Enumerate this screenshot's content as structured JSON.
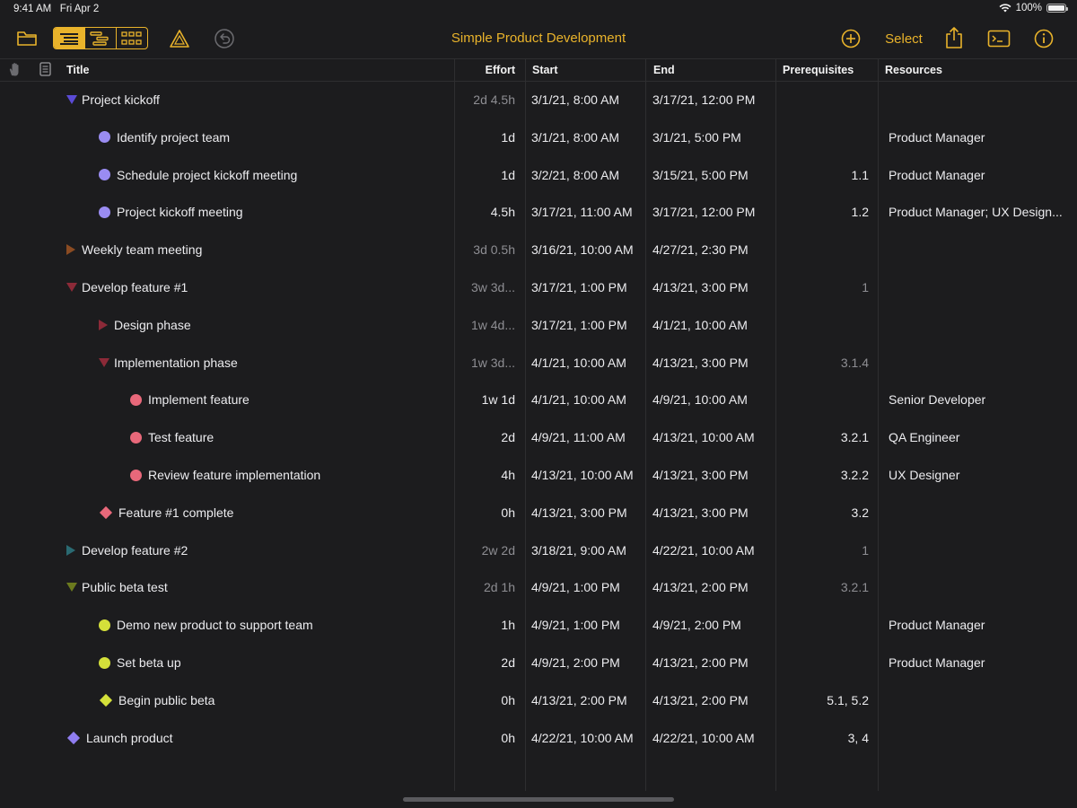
{
  "status": {
    "time": "9:41 AM",
    "date": "Fri Apr 2",
    "battery": "100%",
    "battery_level": 1.0
  },
  "toolbar": {
    "title": "Simple Product Development",
    "select_label": "Select",
    "icons": [
      "folder-icon",
      "outline-view-icon",
      "split-view-icon",
      "gantt-view-icon",
      "warnings-triangle-icon",
      "undo-icon",
      "add-circle-icon",
      "share-icon",
      "console-icon",
      "info-icon"
    ],
    "accent": "#e9b32b"
  },
  "columns": {
    "title": "Title",
    "effort": "Effort",
    "start": "Start",
    "end": "End",
    "prereq": "Prerequisites",
    "resources": "Resources"
  },
  "rows": [
    {
      "title": "Project kickoff",
      "effort": "2d 4.5h",
      "start": "3/1/21, 8:00 AM",
      "end": "3/17/21, 12:00 PM",
      "prereq": "",
      "resources": "",
      "level": 0,
      "marker": "tri-down",
      "color": "#5b4bd6",
      "group": true
    },
    {
      "title": "Identify project team",
      "effort": "1d",
      "start": "3/1/21, 8:00 AM",
      "end": "3/1/21, 5:00 PM",
      "prereq": "",
      "resources": "Product Manager",
      "level": 1,
      "marker": "dot",
      "color": "#9a8cf2",
      "group": false
    },
    {
      "title": "Schedule project kickoff meeting",
      "effort": "1d",
      "start": "3/2/21, 8:00 AM",
      "end": "3/15/21, 5:00 PM",
      "prereq": "1.1",
      "resources": "Product Manager",
      "level": 1,
      "marker": "dot",
      "color": "#9a8cf2",
      "group": false
    },
    {
      "title": "Project kickoff meeting",
      "effort": "4.5h",
      "start": "3/17/21, 11:00 AM",
      "end": "3/17/21, 12:00 PM",
      "prereq": "1.2",
      "resources": "Product Manager; UX Design...",
      "level": 1,
      "marker": "dot",
      "color": "#9a8cf2",
      "group": false
    },
    {
      "title": "Weekly team meeting",
      "effort": "3d 0.5h",
      "start": "3/16/21, 10:00 AM",
      "end": "4/27/21, 2:30 PM",
      "prereq": "",
      "resources": "",
      "level": 0,
      "marker": "tri-right",
      "color": "#8a4b22",
      "group": true
    },
    {
      "title": "Develop feature #1",
      "effort": "3w 3d...",
      "start": "3/17/21, 1:00 PM",
      "end": "4/13/21, 3:00 PM",
      "prereq": "1",
      "resources": "",
      "level": 0,
      "marker": "tri-down",
      "color": "#8c2a38",
      "group": true
    },
    {
      "title": "Design phase",
      "effort": "1w 4d...",
      "start": "3/17/21, 1:00 PM",
      "end": "4/1/21, 10:00 AM",
      "prereq": "",
      "resources": "",
      "level": 1,
      "marker": "tri-right",
      "color": "#8c2a38",
      "group": true
    },
    {
      "title": "Implementation phase",
      "effort": "1w 3d...",
      "start": "4/1/21, 10:00 AM",
      "end": "4/13/21, 3:00 PM",
      "prereq": "3.1.4",
      "resources": "",
      "level": 1,
      "marker": "tri-down",
      "color": "#8c2a38",
      "group": true
    },
    {
      "title": "Implement feature",
      "effort": "1w 1d",
      "start": "4/1/21, 10:00 AM",
      "end": "4/9/21, 10:00 AM",
      "prereq": "",
      "resources": "Senior Developer",
      "level": 2,
      "marker": "dot",
      "color": "#e8687a",
      "group": false
    },
    {
      "title": "Test feature",
      "effort": "2d",
      "start": "4/9/21, 11:00 AM",
      "end": "4/13/21, 10:00 AM",
      "prereq": "3.2.1",
      "resources": "QA Engineer",
      "level": 2,
      "marker": "dot",
      "color": "#e8687a",
      "group": false
    },
    {
      "title": "Review feature implementation",
      "effort": "4h",
      "start": "4/13/21, 10:00 AM",
      "end": "4/13/21, 3:00 PM",
      "prereq": "3.2.2",
      "resources": "UX Designer",
      "level": 2,
      "marker": "dot",
      "color": "#e8687a",
      "group": false
    },
    {
      "title": "Feature #1 complete",
      "effort": "0h",
      "start": "4/13/21, 3:00 PM",
      "end": "4/13/21, 3:00 PM",
      "prereq": "3.2",
      "resources": "",
      "level": 1,
      "marker": "diamond",
      "color": "#e8687a",
      "group": false
    },
    {
      "title": "Develop feature #2",
      "effort": "2w 2d",
      "start": "3/18/21, 9:00 AM",
      "end": "4/22/21, 10:00 AM",
      "prereq": "1",
      "resources": "",
      "level": 0,
      "marker": "tri-right",
      "color": "#2a6a72",
      "group": true
    },
    {
      "title": "Public beta test",
      "effort": "2d 1h",
      "start": "4/9/21, 1:00 PM",
      "end": "4/13/21, 2:00 PM",
      "prereq": "3.2.1",
      "resources": "",
      "level": 0,
      "marker": "tri-down",
      "color": "#6b7a1e",
      "group": true
    },
    {
      "title": "Demo new product to support team",
      "effort": "1h",
      "start": "4/9/21, 1:00 PM",
      "end": "4/9/21, 2:00 PM",
      "prereq": "",
      "resources": "Product Manager",
      "level": 1,
      "marker": "dot",
      "color": "#d4e03a",
      "group": false
    },
    {
      "title": "Set beta up",
      "effort": "2d",
      "start": "4/9/21, 2:00 PM",
      "end": "4/13/21, 2:00 PM",
      "prereq": "",
      "resources": "Product Manager",
      "level": 1,
      "marker": "dot",
      "color": "#d4e03a",
      "group": false
    },
    {
      "title": "Begin public beta",
      "effort": "0h",
      "start": "4/13/21, 2:00 PM",
      "end": "4/13/21, 2:00 PM",
      "prereq": "5.1, 5.2",
      "resources": "",
      "level": 1,
      "marker": "diamond",
      "color": "#d4e03a",
      "group": false
    },
    {
      "title": "Launch product",
      "effort": "0h",
      "start": "4/22/21, 10:00 AM",
      "end": "4/22/21, 10:00 AM",
      "prereq": "3, 4",
      "resources": "",
      "level": 0,
      "marker": "diamond",
      "color": "#8f7df0",
      "group": false
    }
  ]
}
